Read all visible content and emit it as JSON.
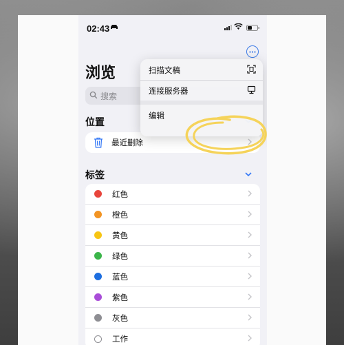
{
  "status_bar": {
    "time": "02:43"
  },
  "header": {
    "title": "浏览",
    "more_icon": "ellipsis-circle-icon"
  },
  "search": {
    "placeholder": "搜索"
  },
  "locations": {
    "heading": "位置",
    "items": [
      {
        "label": "最近删除",
        "icon": "trash-icon"
      }
    ]
  },
  "tags": {
    "heading": "标签",
    "items": [
      {
        "label": "红色",
        "color": "#e8453c"
      },
      {
        "label": "橙色",
        "color": "#f29424"
      },
      {
        "label": "黄色",
        "color": "#f7c514"
      },
      {
        "label": "绿色",
        "color": "#3bb54a"
      },
      {
        "label": "蓝色",
        "color": "#1e6fe0"
      },
      {
        "label": "紫色",
        "color": "#a94dd8"
      },
      {
        "label": "灰色",
        "color": "#8e8e93"
      },
      {
        "label": "工作",
        "color": ""
      }
    ]
  },
  "menu": {
    "items": [
      {
        "label": "扫描文稿",
        "icon": "scan-document-icon"
      },
      {
        "label": "连接服务器",
        "icon": "monitor-icon"
      },
      {
        "label": "编辑",
        "icon": ""
      }
    ]
  },
  "colors": {
    "accent": "#3478f6",
    "highlight": "#f5d35a"
  }
}
